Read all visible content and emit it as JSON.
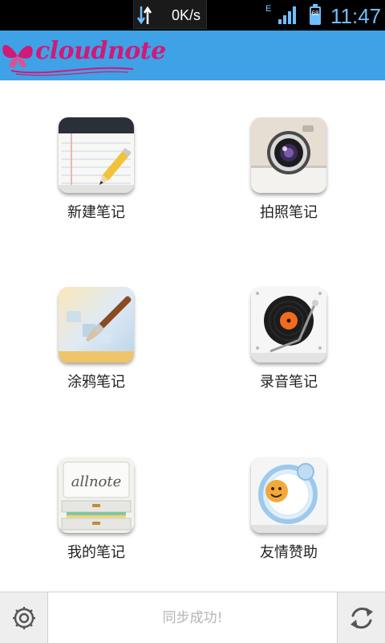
{
  "status_bar": {
    "net_speed": "0K/s",
    "network_type": "E",
    "battery": "68",
    "time": "11:47"
  },
  "header": {
    "logo_text": "cloudnote"
  },
  "grid": {
    "items": [
      {
        "label": "新建笔记",
        "icon": "notepad-pencil-icon"
      },
      {
        "label": "拍照笔记",
        "icon": "camera-icon"
      },
      {
        "label": "涂鸦笔记",
        "icon": "paintbrush-icon"
      },
      {
        "label": "录音笔记",
        "icon": "record-player-icon"
      },
      {
        "label": "我的笔记",
        "icon": "drawer-cabinet-icon"
      },
      {
        "label": "友情赞助",
        "icon": "smiley-ring-icon"
      }
    ]
  },
  "bottom_bar": {
    "status_text": "同步成功!",
    "settings_icon": "gear-icon",
    "sync_icon": "refresh-icon"
  },
  "colors": {
    "header_bg": "#3fa1e6",
    "logo": "#d01a78",
    "status_text": "#b5b5b5"
  }
}
